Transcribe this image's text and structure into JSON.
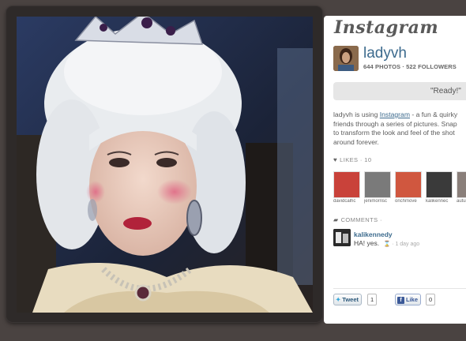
{
  "photo": {
    "subject": "selfie-costume"
  },
  "sidebar": {
    "logo": "Instagram",
    "username": "ladyvh",
    "stats": "644 PHOTOS · 522 FOLLOWERS",
    "caption": "\"Ready!\"",
    "blurb": {
      "line1_prefix": "ladyvh is using ",
      "line1_link": "Instagram",
      "line1_suffix": " - a fun & quirky",
      "line2": "friends through a series of pictures. Snap",
      "line3": "to transform the look and feel of the shot",
      "line4": "around forever."
    },
    "likes": {
      "label": "LIKES · 10",
      "icon": "heart-icon",
      "users": [
        {
          "name": "davidcalhc",
          "color": "#c9423a"
        },
        {
          "name": "jenimorrisc",
          "color": "#7a7a7a"
        },
        {
          "name": "onchmove",
          "color": "#d0573f"
        },
        {
          "name": "kalikennec",
          "color": "#3a3a3a"
        },
        {
          "name": "autu",
          "color": "#8a7f7a"
        }
      ]
    },
    "comments": {
      "label": "COMMENTS ·",
      "icon": "speech-bubble-icon",
      "items": [
        {
          "user": "kalikennedy",
          "text": "HA! yes.",
          "time": "1 day ago"
        }
      ]
    },
    "share": {
      "tweet_label": "Tweet",
      "tweet_count": "1",
      "like_label": "Like",
      "like_count": "0"
    }
  },
  "colors": {
    "background": "#4a4341",
    "link": "#3d6b8e",
    "panel": "#ffffff"
  }
}
